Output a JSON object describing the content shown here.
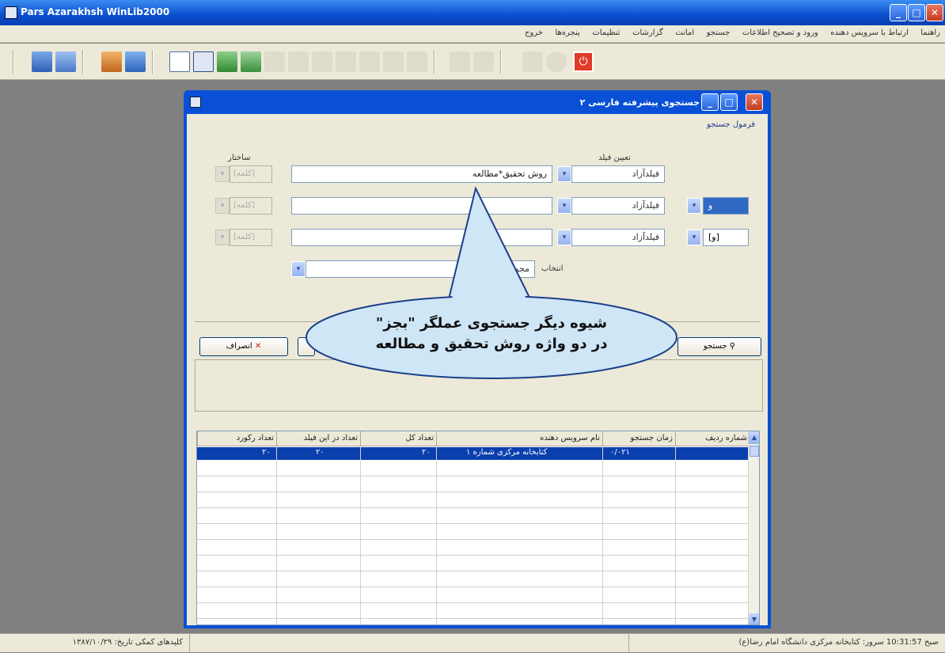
{
  "window": {
    "title": "Pars Azarakhsh WinLib2000"
  },
  "menu": [
    "راهنما",
    "ارتباط با سرویس دهنده",
    "ورود و تصحیح اطلاعات",
    "جستجو",
    "امانت",
    "گزارشات",
    "تنظیمات",
    "پنجره‌ها",
    "خروج"
  ],
  "toolbar_icons": [
    "users-icon",
    "user-search-icon",
    "people-icon",
    "network-icon",
    "new-page-icon",
    "form-icon",
    "excel-icon",
    "excel-export-icon",
    "copy-icon",
    "save-icon",
    "undo-icon",
    "redo-icon",
    "page-icon",
    "lock-icon",
    "printer-icon",
    "paste-icon",
    "clipboard-icon",
    "calculator-icon",
    "help-circle-icon",
    "power-icon"
  ],
  "dialog": {
    "title": "جستجوی پیشرفته فارسی ۲",
    "frame_label": "فرمول جستجو",
    "col_field": "تعیین فیلد",
    "col_structure": "ساختار",
    "rows": [
      {
        "field": "فیلدآزاد",
        "text": "روش تحقیق*مطالعه",
        "struct": "[کلمه]",
        "op": ""
      },
      {
        "field": "فیلدآزاد",
        "text": "",
        "struct": "[کلمه]",
        "op": "و"
      },
      {
        "field": "فیلدآزاد",
        "text": "",
        "struct": "[کلمه]",
        "op": "[و]"
      }
    ],
    "select_label": "انتخاب",
    "select_value": "مجموعه مدارک",
    "cancel_label": "انصراف",
    "search_label": "جستجو"
  },
  "callout": {
    "line1": "شیوه دیگر جستجوی عملگر \"بجز\"",
    "line2": "در دو واژه روش تحقیق و مطالعه"
  },
  "table": {
    "headers": [
      "شماره ردیف",
      "زمان جستجو",
      "نام سرویس دهنده",
      "تعداد کل",
      "تعداد در این فیلد",
      "تعداد رکورد"
    ],
    "row": [
      "",
      "۰/۰۲۱",
      "کتابخانه مرکزی شماره ۱",
      "۲۰",
      "۲۰",
      "۲۰"
    ]
  },
  "status": {
    "right": "صبح 10:31:57  سرور: کتابخانه مرکزی دانشگاه امام رضا(ع)",
    "left": "کلیدهای کمکی  تاریخ: ۱۳۸۷/۱۰/۲۹"
  },
  "colors": {
    "titlebar": "#0a4fd0",
    "face": "#ece9d8",
    "desktop": "#808080",
    "selection": "#0a3fae",
    "callout": "#cfe6f7"
  }
}
